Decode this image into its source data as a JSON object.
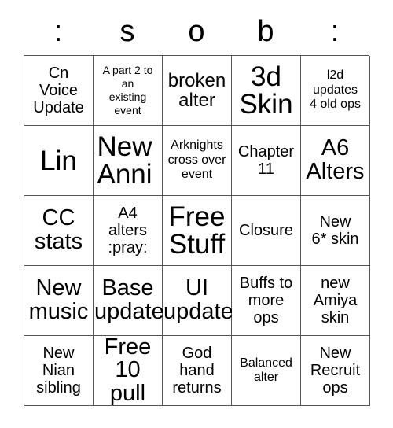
{
  "card": {
    "title_letters": [
      ":",
      "s",
      "o",
      "b",
      ":"
    ],
    "columns": 5,
    "rows": 5,
    "border_color": "#555555",
    "background_color": "#ffffff",
    "text_color": "#000000",
    "cells": [
      [
        {
          "text": "Cn\nVoice\nUpdate",
          "size": "md"
        },
        {
          "text": "A part 2 to\nan\nexisting\nevent",
          "size": "xs"
        },
        {
          "text": "broken\nalter",
          "size": "lg"
        },
        {
          "text": "3d\nSkin",
          "size": "xxl"
        },
        {
          "text": "l2d\nupdates\n4 old ops",
          "size": "sm"
        }
      ],
      [
        {
          "text": "Lin",
          "size": "xxl"
        },
        {
          "text": "New\nAnni",
          "size": "xxl",
          "overflow": true
        },
        {
          "text": "Arknights\ncross over\nevent",
          "size": "sm"
        },
        {
          "text": "Chapter\n11",
          "size": "md"
        },
        {
          "text": "A6\nAlters",
          "size": "xl"
        }
      ],
      [
        {
          "text": "CC\nstats",
          "size": "xl"
        },
        {
          "text": "A4\nalters\n:pray:",
          "size": "md"
        },
        {
          "text": "Free\nStuff",
          "size": "xxl"
        },
        {
          "text": "Closure",
          "size": "md"
        },
        {
          "text": "New\n6* skin",
          "size": "md"
        }
      ],
      [
        {
          "text": "New\nmusic",
          "size": "xl"
        },
        {
          "text": "Base\nupdate",
          "size": "xl"
        },
        {
          "text": "UI\nupdate",
          "size": "xl"
        },
        {
          "text": "Buffs to\nmore\nops",
          "size": "md"
        },
        {
          "text": "new\nAmiya\nskin",
          "size": "md"
        }
      ],
      [
        {
          "text": "New\nNian\nsibling",
          "size": "md"
        },
        {
          "text": "Free\n10 pull",
          "size": "xl"
        },
        {
          "text": "God\nhand\nreturns",
          "size": "md"
        },
        {
          "text": "Balanced\nalter",
          "size": "sm"
        },
        {
          "text": "New\nRecruit\nops",
          "size": "md"
        }
      ]
    ]
  }
}
